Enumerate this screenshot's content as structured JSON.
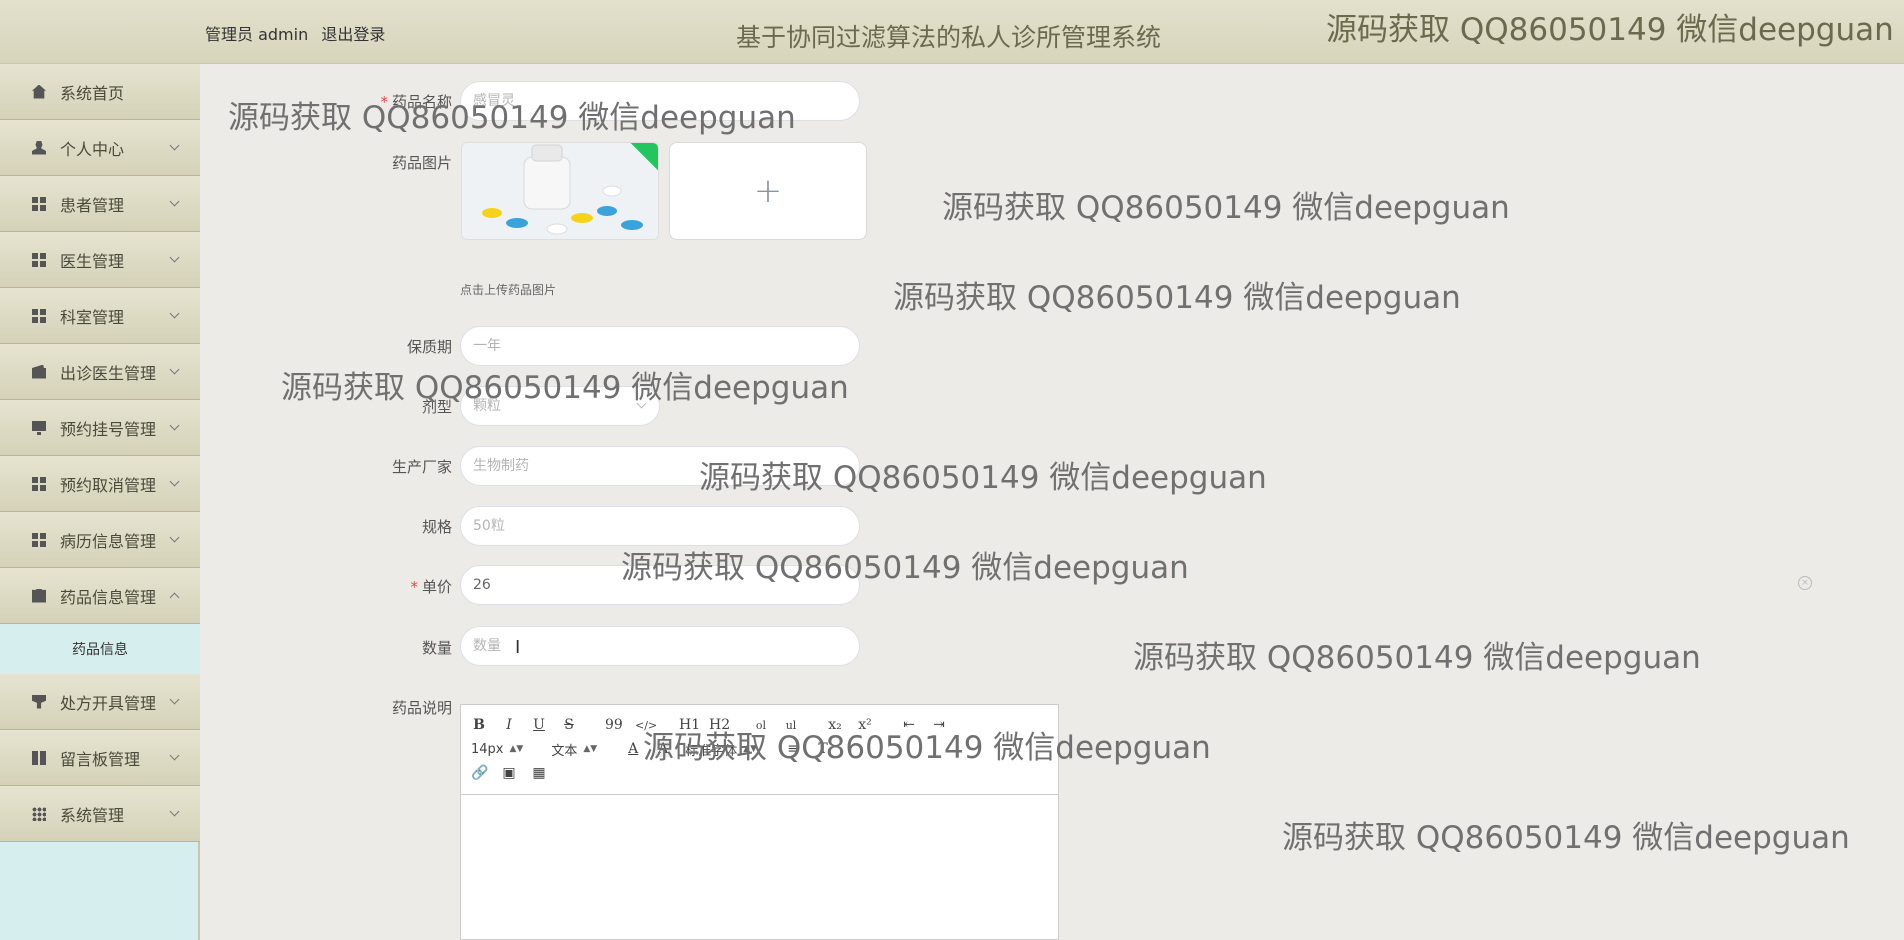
{
  "header": {
    "user_label": "管理员 admin",
    "logout_label": "退出登录",
    "title": "基于协同过滤算法的私人诊所管理系统"
  },
  "sidebar": {
    "items": [
      {
        "label": "系统首页",
        "icon": "home-icon"
      },
      {
        "label": "个人中心",
        "icon": "user-icon"
      },
      {
        "label": "患者管理",
        "icon": "grid-icon"
      },
      {
        "label": "医生管理",
        "icon": "grid-icon"
      },
      {
        "label": "科室管理",
        "icon": "grid-icon"
      },
      {
        "label": "出诊医生管理",
        "icon": "wallet-icon"
      },
      {
        "label": "预约挂号管理",
        "icon": "monitor-icon"
      },
      {
        "label": "预约取消管理",
        "icon": "grid-icon"
      },
      {
        "label": "病历信息管理",
        "icon": "grid-icon"
      },
      {
        "label": "药品信息管理",
        "icon": "clipboard-icon"
      },
      {
        "label": "处方开具管理",
        "icon": "cup-icon"
      },
      {
        "label": "留言板管理",
        "icon": "book-icon"
      },
      {
        "label": "系统管理",
        "icon": "apps-icon"
      }
    ],
    "sub_item": "药品信息"
  },
  "form": {
    "name_label": "药品名称",
    "name_placeholder": "感冒灵",
    "image_label": "药品图片",
    "upload_plus": "+",
    "upload_hint": "点击上传药品图片",
    "shelf_label": "保质期",
    "shelf_placeholder": "一年",
    "type_label": "剂型",
    "type_value": "颗粒",
    "maker_label": "生产厂家",
    "maker_placeholder": "生物制药",
    "spec_label": "规格",
    "spec_placeholder": "50粒",
    "price_label": "单价",
    "price_value": "26",
    "qty_label": "数量",
    "qty_placeholder": "数量",
    "desc_label": "药品说明",
    "required_mark": "*"
  },
  "editor": {
    "row1": [
      "B",
      "I",
      "U",
      "S",
      "99",
      "</>",
      "H1",
      "H2",
      "ol",
      "ul",
      "x₂",
      "x²",
      "⇤",
      "⇥"
    ],
    "font_size": "14px",
    "font_family": "文本",
    "header_select": "标准字体"
  },
  "watermark": "源码获取 QQ86050149 微信deepguan",
  "colors": {
    "header_bg": "#d8d5bd",
    "sidebar_bg": "#d6efee",
    "menu_bg": "#d5d2b9",
    "required": "#e34a4a",
    "badge": "#22c55e"
  }
}
